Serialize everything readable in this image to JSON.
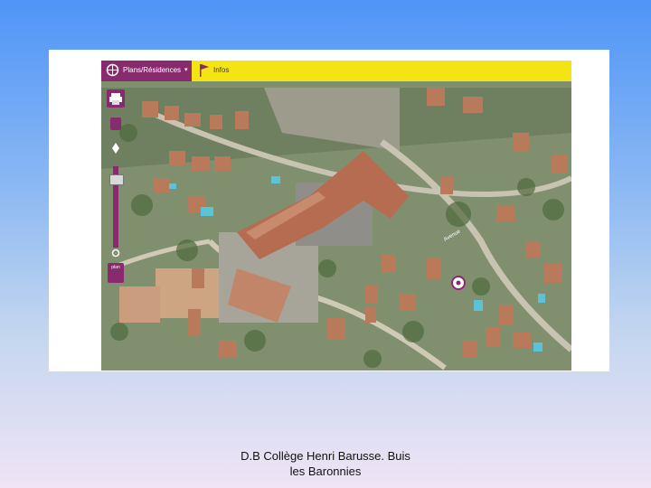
{
  "slide": {
    "caption_line1": "D.B Collège Henri Barusse. Buis",
    "caption_line2": "les Baronnies"
  },
  "map_viewer": {
    "toolbar": {
      "background_color": "#f4e414",
      "accent_color": "#8a2a6e",
      "left_menu_label": "Plans/Résidences",
      "left_menu_icon": "compass-icon",
      "dropdown_icon": "chevron-down-icon",
      "flag_icon": "flag-icon",
      "flag_label": "Infos"
    },
    "side_controls": {
      "print_icon": "printer-icon",
      "zoom_icon": "zoom-icon",
      "navigation_icon": "navigation-icon",
      "zoom_slider_icon": "zoom-slider",
      "layer_button_label": "plan"
    },
    "aerial_image": {
      "description_icon": "aerial-photo",
      "road_label": "Avenue"
    }
  }
}
